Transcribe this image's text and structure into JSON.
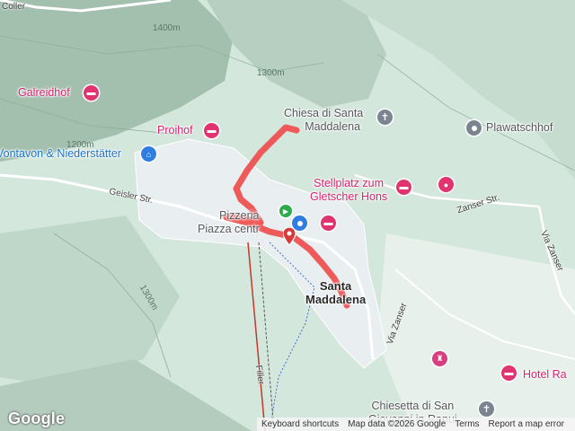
{
  "map": {
    "places": {
      "galreidhof": "Galreidhof",
      "proihof": "Proihof",
      "vontavon": "Vontavon & Niederstätter",
      "chiesa_line1": "Chiesa di Santa",
      "chiesa_line2": "Maddalena",
      "plawatschhof": "Plawatschhof",
      "stellplatz_line1": "Stellplatz zum",
      "stellplatz_line2": "Gletscher Hons",
      "pizza_line1": "Pizzeria",
      "pizza_line2": "Piazza centr",
      "village_line1": "Santa",
      "village_line2": "Maddalena",
      "hotel_ra": "Hotel Ra",
      "chiesetta_line1": "Chiesetta di San",
      "chiesetta_line2": "Giovanni in Ranui",
      "coller": "Coller"
    },
    "streets": {
      "geisler": "Geisler Str.",
      "zanser_str": "Zanser Str.",
      "via_zanser": "Via Zanser",
      "via_zanser2": "Via Zanser",
      "filler": "Filler"
    },
    "contours": [
      "1400m",
      "1300m",
      "1200m",
      "1300m"
    ],
    "icons": {
      "hotel": "bed-icon",
      "church": "cross-icon",
      "place": "pin-dot-icon",
      "camera": "camera-icon",
      "shopping": "shopping-cart-icon",
      "start": "play-icon",
      "end": "map-pin-icon",
      "castle": "castle-icon"
    },
    "colors": {
      "route": "#ee5a5a",
      "hotel": "#e0336f",
      "terrain": "#cfe3d8"
    }
  },
  "footer": {
    "google": "Google",
    "keyboard": "Keyboard shortcuts",
    "mapdata": "Map data ©2026 Google",
    "terms": "Terms",
    "report": "Report a map error"
  }
}
